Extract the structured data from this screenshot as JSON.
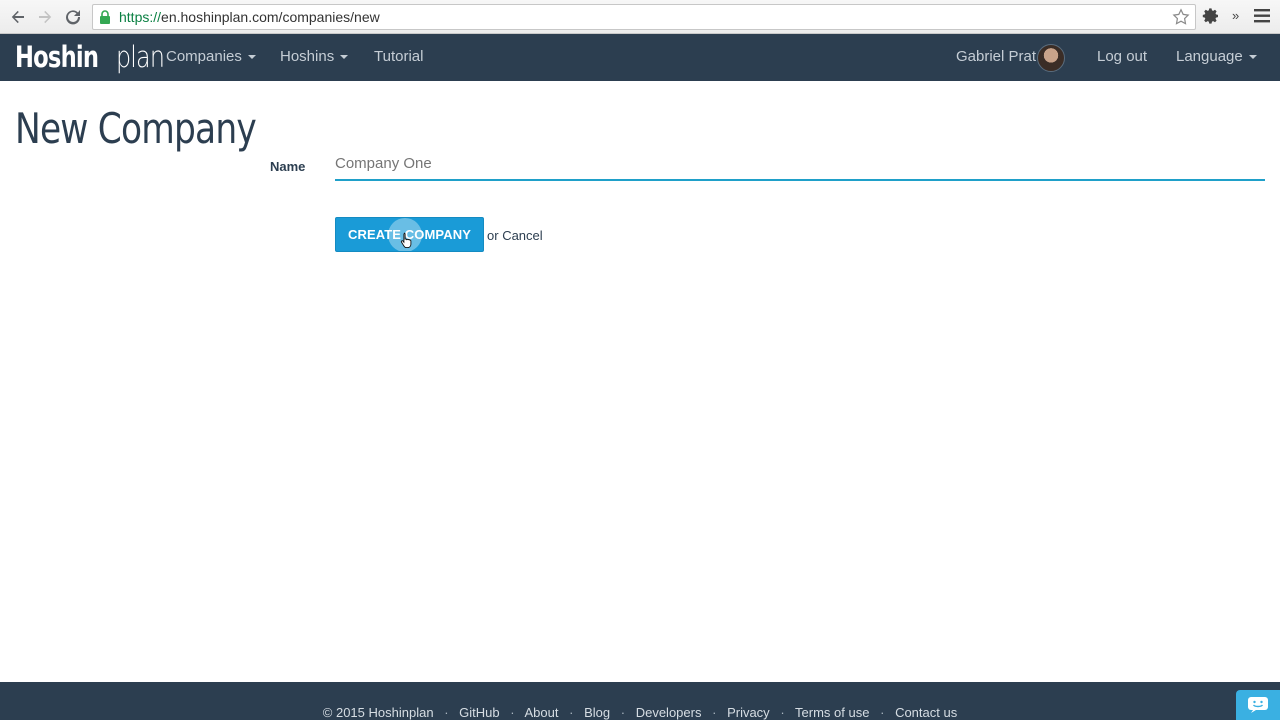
{
  "browser": {
    "url_scheme": "https://",
    "url_rest": "en.hoshinplan.com/companies/new",
    "extensions_label": "»"
  },
  "navbar": {
    "brand_bold": "Hoshin",
    "brand_light": "plan",
    "items": [
      {
        "label": "Companies"
      },
      {
        "label": "Hoshins"
      },
      {
        "label": "Tutorial"
      }
    ],
    "user_name": "Gabriel Prat",
    "logout_label": "Log out",
    "language_label": "Language"
  },
  "main": {
    "title": "New Company",
    "name_label": "Name",
    "name_placeholder": "Company One",
    "name_value": "",
    "create_button": "Create Company",
    "or_text": "or",
    "cancel_label": "Cancel"
  },
  "footer": {
    "copyright": "© 2015 Hoshinplan",
    "links": [
      "GitHub",
      "About",
      "Blog",
      "Developers",
      "Privacy",
      "Terms of use",
      "Contact us"
    ],
    "separator": "·"
  },
  "colors": {
    "navbar_bg": "#2c3e50",
    "accent": "#1a9bd7",
    "input_underline": "#1fa0c9"
  }
}
